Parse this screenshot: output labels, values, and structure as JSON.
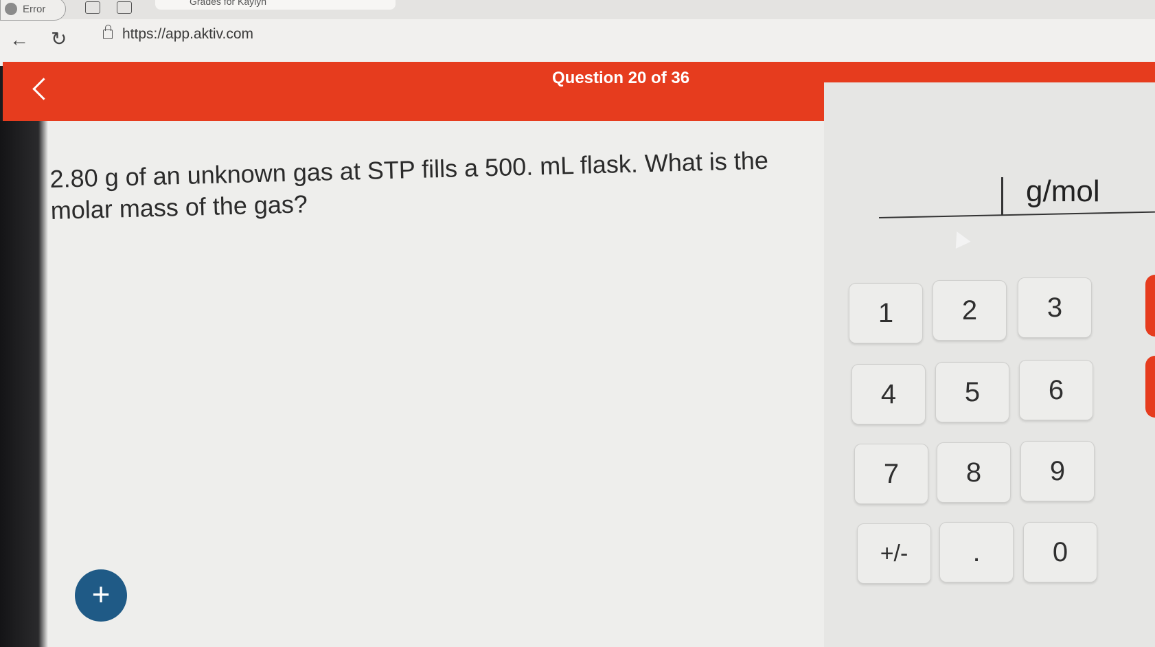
{
  "browser": {
    "error_label": "Error",
    "active_tab_title": "Grades for Kaylyn",
    "url": "https://app.aktiv.com",
    "back_glyph": "←",
    "reload_glyph": "↻"
  },
  "header": {
    "question_counter": "Question 20 of 36",
    "back_icon": "chevron-left-icon"
  },
  "question": {
    "text": "2.80 g of an unknown gas at STP fills a 500. mL flask. What is the molar mass of the gas?"
  },
  "answer": {
    "value": "",
    "unit": "g/mol"
  },
  "keypad": {
    "keys": [
      "1",
      "2",
      "3",
      "4",
      "5",
      "6",
      "7",
      "8",
      "9",
      "+/-",
      ".",
      "0"
    ]
  },
  "fab": {
    "label": "+"
  },
  "colors": {
    "accent": "#e63c1e",
    "fab": "#1f5a86",
    "pane": "#eeeeec"
  }
}
